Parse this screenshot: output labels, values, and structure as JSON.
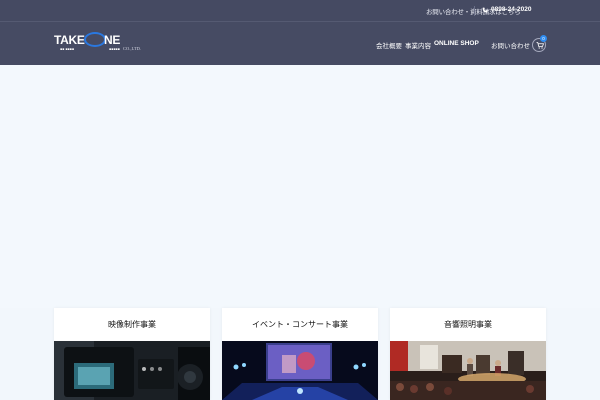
{
  "topbar": {
    "contact_label": "お問い合わせ・資料請求はこちら",
    "phone": "0898-24-2020"
  },
  "logo": {
    "word_left": "TAKE",
    "word_right": "NE",
    "company": "CO.,LTD."
  },
  "nav": {
    "items": [
      {
        "label": "会社概要"
      },
      {
        "label": "事業内容"
      },
      {
        "label": "ONLINE SHOP"
      },
      {
        "label": "お問い合わせ"
      }
    ],
    "cart_count": "0"
  },
  "services": [
    {
      "title": "映像制作事業"
    },
    {
      "title": "イベント・コンサート事業"
    },
    {
      "title": "音響照明事業"
    }
  ],
  "colors": {
    "header_bg": "#464b63",
    "accent": "#2f8cf0",
    "page_bg": "#f2f7fc"
  }
}
